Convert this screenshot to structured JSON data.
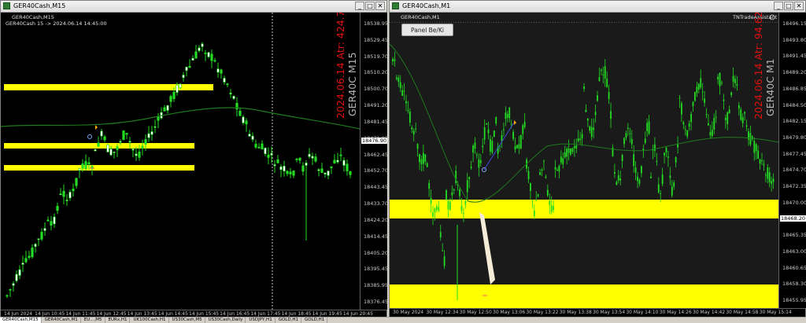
{
  "window_left": {
    "title": "GER40Cash,M15",
    "chart_label": "GER40Cash,M15",
    "info_line": "GER40Cash 15 -> 2024.06.14 14:45:00",
    "vertical_date_atr": "2024.06.14 Atr: 424.71",
    "vertical_symbol_tf": "GER40C M15",
    "price_labels": [
      "18538.95",
      "18529.45",
      "18519.70",
      "18510.20",
      "18500.70",
      "18491.20",
      "18481.45",
      "18471.95",
      "18462.45",
      "18452.70",
      "18443.45",
      "18433.70",
      "18424.20",
      "18414.45",
      "18405.20",
      "18395.45",
      "18385.95",
      "18376.45"
    ],
    "highlight_price": "18476.90",
    "time_labels": [
      "14 Jun 2024",
      "14 Jun 10:45",
      "14 Jun 11:45",
      "14 Jun 12:45",
      "14 Jun 13:45",
      "14 Jun 14:45",
      "14 Jun 15:45",
      "14 Jun 16:45",
      "14 Jun 17:45",
      "14 Jun 18:45",
      "14 Jun 19:45",
      "14 Jun 20:45"
    ]
  },
  "window_right": {
    "title": "GER40Cash,M1",
    "chart_label": "GER40Cash,M1",
    "panel_button": "Panel Be/Ki",
    "brand": "TNTradeAssistant",
    "vertical_date_atr": "2024.06.14 Atr: 94.62",
    "vertical_symbol_tf": "GER40C M1",
    "price_labels": [
      "18496.15",
      "18493.80",
      "18491.45",
      "18489.20",
      "18486.85",
      "18484.50",
      "18482.15",
      "18479.80",
      "18477.45",
      "18474.70",
      "18472.35",
      "18470.00",
      "18467.70",
      "18465.35",
      "18463.00",
      "18460.65",
      "18458.30",
      "18455.95"
    ],
    "highlight_price": "18468.20",
    "time_labels": [
      "30 May 2024",
      "30 May 12:34",
      "30 May 12:50",
      "30 May 13:06",
      "30 May 13:22",
      "30 May 13:38",
      "30 May 13:54",
      "30 May 14:10",
      "30 May 14:26",
      "30 May 14:42",
      "30 May 14:58",
      "30 May 15:14"
    ]
  },
  "tabs": [
    "GER40Cash,M15",
    "GER40Cash,M1",
    "EU...,M5",
    "EURx,H1",
    "UK100Cash,H1",
    "US30Cash,M5",
    "US30Cash,Daily",
    "USDJPY,H1",
    "GOLD,H1",
    "GOLD,H1"
  ],
  "colors": {
    "bull_candle": "#22dd22",
    "bear_candle": "#22dd22",
    "zone_yellow": "#ffff00",
    "ma_line": "#1e7a1e",
    "date_text_red": "#e01010",
    "symbol_text_silver": "#b4b4b4"
  },
  "icons": {
    "window_icon": "chart-window-icon",
    "minimize": "minimize-icon",
    "restore": "restore-icon",
    "close": "close-icon"
  }
}
